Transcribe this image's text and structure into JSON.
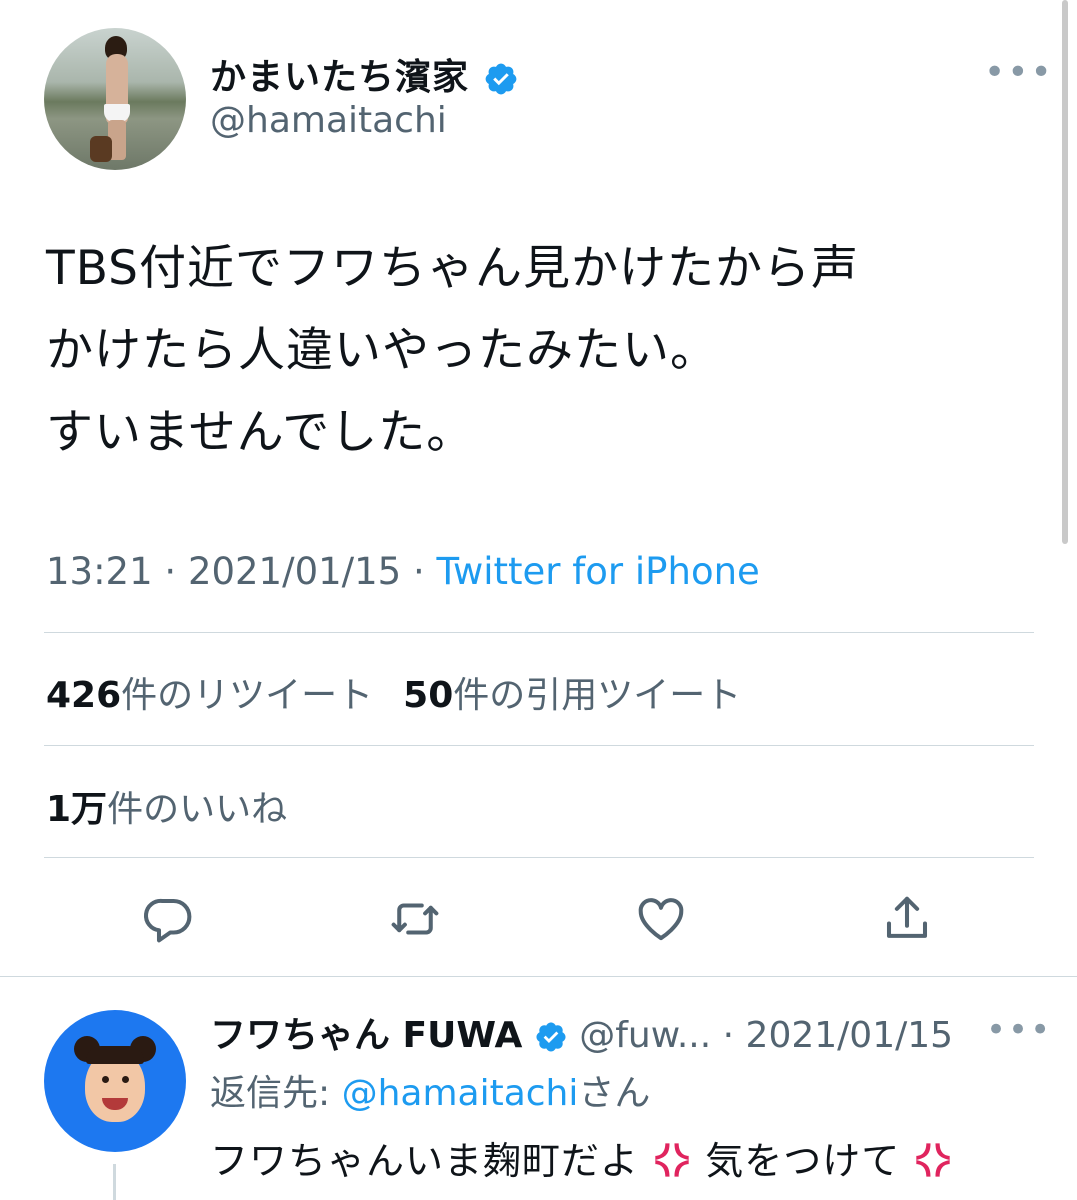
{
  "tweet": {
    "author_name": "かまいたち濱家",
    "author_handle": "@hamaitachi",
    "verified_icon": "verified-badge-icon",
    "more_icon": "more-horizontal-icon",
    "text_lines": [
      "TBS付近でフワちゃん見かけたから声",
      "かけたら人違いやったみたい。",
      "すいませんでした。"
    ],
    "time": "13:21",
    "separator": "·",
    "date": "2021/01/15",
    "source": "Twitter for iPhone"
  },
  "stats": {
    "retweets_count": "426",
    "retweets_label": "件のリツイート",
    "quotes_count": "50",
    "quotes_label": "件の引用ツイート",
    "likes_count": "1万",
    "likes_label": "件のいいね"
  },
  "actions": [
    "reply-icon",
    "retweet-icon",
    "like-icon",
    "share-icon"
  ],
  "reply": {
    "author_name": "フワちゃん FUWA",
    "author_handle": "@fuw...",
    "separator": "·",
    "date": "2021/01/15",
    "reply_to_label": "返信先: ",
    "reply_to_mention": "@hamaitachi",
    "reply_to_suffix": "さん",
    "text_part1": "フワちゃんいま麹町だよ",
    "text_part2": "気をつけて"
  },
  "colors": {
    "accent": "#1d9bf0",
    "secondary_text": "#536471",
    "divider": "#cfd9de"
  }
}
